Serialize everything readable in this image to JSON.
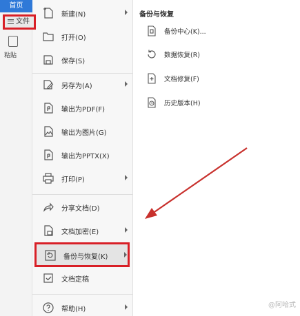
{
  "app": {
    "home_tab": "首页",
    "file_button": "文件",
    "paste_label": "粘贴"
  },
  "menu": {
    "items": [
      {
        "label": "新建(N)",
        "icon": "new-file-icon",
        "has_submenu": true
      },
      {
        "label": "打开(O)",
        "icon": "folder-open-icon",
        "has_submenu": false
      },
      {
        "label": "保存(S)",
        "icon": "save-icon",
        "has_submenu": false
      },
      {
        "label": "另存为(A)",
        "icon": "save-as-icon",
        "has_submenu": true
      },
      {
        "label": "输出为PDF(F)",
        "icon": "pdf-icon",
        "has_submenu": false
      },
      {
        "label": "输出为图片(G)",
        "icon": "image-icon",
        "has_submenu": false
      },
      {
        "label": "输出为PPTX(X)",
        "icon": "pptx-icon",
        "has_submenu": false
      },
      {
        "label": "打印(P)",
        "icon": "print-icon",
        "has_submenu": true
      },
      {
        "label": "分享文档(D)",
        "icon": "share-icon",
        "has_submenu": false
      },
      {
        "label": "文档加密(E)",
        "icon": "encrypt-icon",
        "has_submenu": true
      },
      {
        "label": "备份与恢复(K)",
        "icon": "backup-icon",
        "has_submenu": true
      },
      {
        "label": "文档定稿",
        "icon": "finalize-icon",
        "has_submenu": false
      },
      {
        "label": "帮助(H)",
        "icon": "help-icon",
        "has_submenu": true
      }
    ]
  },
  "submenu": {
    "title": "备份与恢复",
    "items": [
      {
        "label": "备份中心(K)...",
        "icon": "backup-center-icon"
      },
      {
        "label": "数据恢复(R)",
        "icon": "data-recovery-icon"
      },
      {
        "label": "文档修复(F)",
        "icon": "document-repair-icon"
      },
      {
        "label": "历史版本(H)",
        "icon": "history-version-icon"
      }
    ]
  },
  "watermark": "@阿哈式",
  "colors": {
    "highlight_border": "#d81f26",
    "annotation_arrow": "#c8302c",
    "home_tab": "#2f79d8"
  }
}
